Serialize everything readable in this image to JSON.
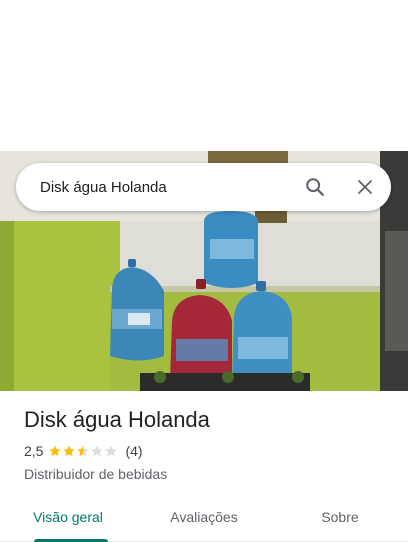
{
  "search": {
    "value": "Disk água Holanda"
  },
  "place": {
    "name": "Disk água Holanda",
    "rating": "2,5",
    "rating_value": 2.5,
    "rating_max": 5,
    "review_count": "(4)",
    "category": "Distribuidor de bebidas"
  },
  "tabs": [
    {
      "label": "Visão geral",
      "active": true
    },
    {
      "label": "Avaliações",
      "active": false
    },
    {
      "label": "Sobre",
      "active": false
    }
  ],
  "colors": {
    "accent": "#00796b",
    "star": "#fbbc04",
    "star_empty": "#dadce0"
  }
}
